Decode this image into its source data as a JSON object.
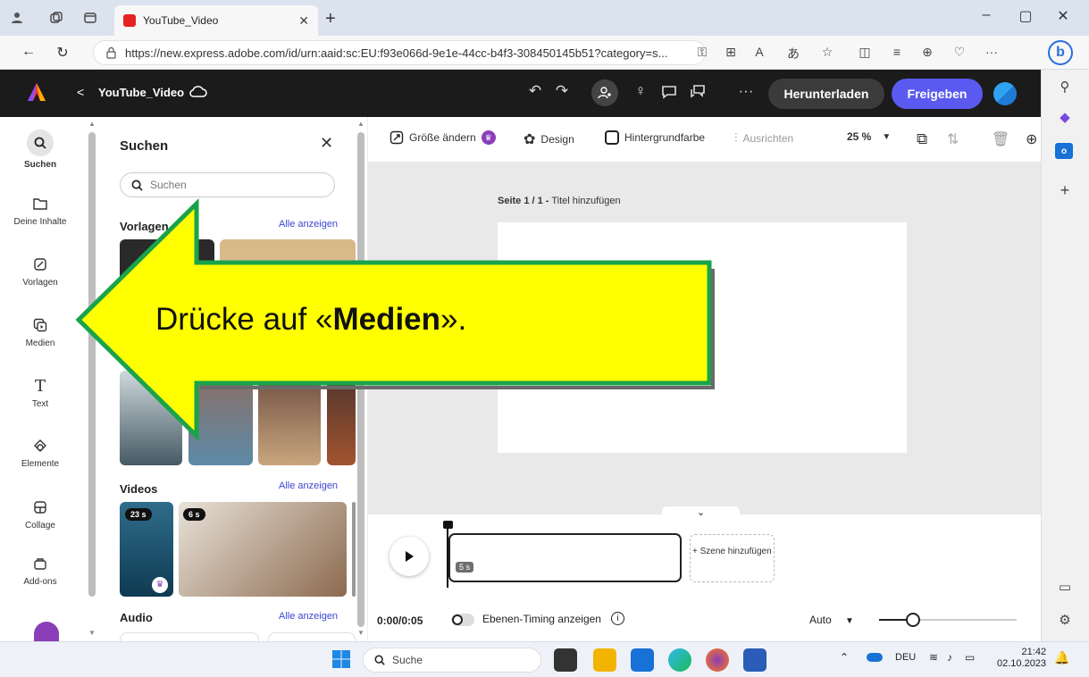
{
  "browser": {
    "tab_title": "YouTube_Video",
    "new_tab": "+",
    "url": "https://new.express.adobe.com/id/urn:aaid:sc:EU:f93e066d-9e1e-44cc-b4f3-308450145b51?category=s...",
    "window_controls": {
      "minimize": "–",
      "restore": "▢",
      "close": "✕"
    }
  },
  "app": {
    "doc_title": "YouTube_Video",
    "back": "<",
    "download_label": "Herunterladen",
    "share_label": "Freigeben"
  },
  "rail": [
    {
      "label": "Suchen",
      "icon": "search-icon"
    },
    {
      "label": "Deine Inhalte",
      "icon": "folder-icon"
    },
    {
      "label": "Vorlagen",
      "icon": "templates-icon"
    },
    {
      "label": "Medien",
      "icon": "media-icon"
    },
    {
      "label": "Text",
      "icon": "text-icon"
    },
    {
      "label": "Elemente",
      "icon": "elements-icon"
    },
    {
      "label": "Collage",
      "icon": "collage-icon"
    },
    {
      "label": "Add-ons",
      "icon": "addons-icon"
    }
  ],
  "panel": {
    "title": "Suchen",
    "search_placeholder": "Suchen",
    "sections": {
      "templates": {
        "title": "Vorlagen",
        "link": "Alle anzeigen"
      },
      "videos": {
        "title": "Videos",
        "link": "Alle anzeigen",
        "durations": [
          "23 s",
          "6 s"
        ]
      },
      "audio": {
        "title": "Audio",
        "link": "Alle anzeigen"
      }
    }
  },
  "toolbar": {
    "resize": "Größe ändern",
    "design": "Design",
    "bg_color": "Hintergrundfarbe",
    "align": "Ausrichten",
    "zoom": "25 %"
  },
  "canvas": {
    "page_prefix": "Seite 1 / 1 -",
    "page_title_hint": "Titel hinzufügen"
  },
  "timeline": {
    "clip_duration": "5 s",
    "add_scene": "+ Szene hinzufügen",
    "timecode": "0:00/0:05",
    "layer_timing": "Ebenen-Timing anzeigen",
    "auto": "Auto"
  },
  "callout": {
    "prefix": "Drücke auf «",
    "bold": "Medien",
    "suffix": "»."
  },
  "taskbar": {
    "search": "Suche",
    "lang": "DEU",
    "time": "21:42",
    "date": "02.10.2023"
  },
  "colors": {
    "accent": "#5a5af0",
    "callout_fill": "#ffff00",
    "callout_border": "#1aa34a"
  }
}
